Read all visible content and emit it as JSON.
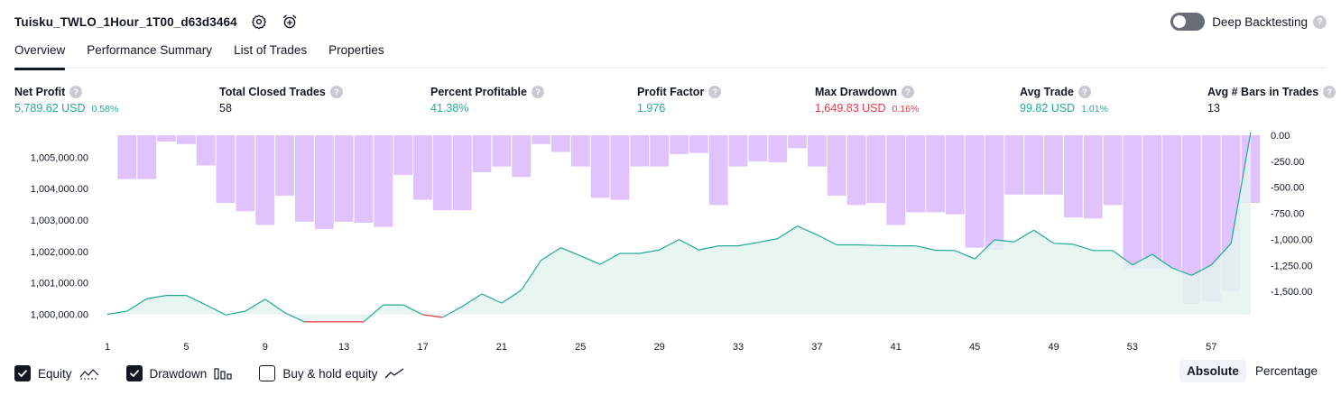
{
  "header": {
    "strategy_name": "Tuisku_TWLO_1Hour_1T00_d63d3464",
    "deep_backtesting_label": "Deep Backtesting",
    "help_glyph": "?"
  },
  "tabs": [
    {
      "label": "Overview",
      "active": true
    },
    {
      "label": "Performance Summary",
      "active": false
    },
    {
      "label": "List of Trades",
      "active": false
    },
    {
      "label": "Properties",
      "active": false
    }
  ],
  "metrics": {
    "net_profit": {
      "label": "Net Profit",
      "value": "5,789.62 USD",
      "pct": "0.58%"
    },
    "total_closed_trades": {
      "label": "Total Closed Trades",
      "value": "58"
    },
    "percent_profitable": {
      "label": "Percent Profitable",
      "value": "41.38%"
    },
    "profit_factor": {
      "label": "Profit Factor",
      "value": "1.976"
    },
    "max_drawdown": {
      "label": "Max Drawdown",
      "value": "1,649.83 USD",
      "pct": "0.16%"
    },
    "avg_trade": {
      "label": "Avg Trade",
      "value": "99.82 USD",
      "pct": "1.01%"
    },
    "avg_bars": {
      "label": "Avg # Bars in Trades",
      "value": "13"
    }
  },
  "colors": {
    "profit": "#22ab94",
    "loss": "#f23645",
    "drawdown_bar": "#dab7fd",
    "equity_fill": "#e3f4ef",
    "text": "#131722"
  },
  "chart_data": {
    "type": "line",
    "x": [
      1,
      2,
      3,
      4,
      5,
      6,
      7,
      8,
      9,
      10,
      11,
      12,
      13,
      14,
      15,
      16,
      17,
      18,
      19,
      20,
      21,
      22,
      23,
      24,
      25,
      26,
      27,
      28,
      29,
      30,
      31,
      32,
      33,
      34,
      35,
      36,
      37,
      38,
      39,
      40,
      41,
      42,
      43,
      44,
      45,
      46,
      47,
      48,
      49,
      50,
      51,
      52,
      53,
      54,
      55,
      56,
      57,
      58,
      59
    ],
    "x_tick_labels": [
      "1",
      "5",
      "9",
      "13",
      "17",
      "21",
      "25",
      "29",
      "33",
      "37",
      "41",
      "45",
      "49",
      "53",
      "57"
    ],
    "series": [
      {
        "kind": "equity",
        "axis": "left",
        "values": [
          1000000,
          1000100,
          1000500,
          1000600,
          1000600,
          1000300,
          999980,
          1000100,
          1000480,
          1000050,
          999760,
          999760,
          999760,
          999760,
          1000300,
          1000300,
          999990,
          999900,
          1000250,
          1000650,
          1000360,
          1000770,
          1001720,
          1002120,
          1001860,
          1001590,
          1001940,
          1001940,
          1002050,
          1002380,
          1002050,
          1002180,
          1002180,
          1002290,
          1002410,
          1002810,
          1002530,
          1002210,
          1002210,
          1002190,
          1002180,
          1002180,
          1002040,
          1002030,
          1001760,
          1002370,
          1002310,
          1002680,
          1002260,
          1002230,
          1002030,
          1002030,
          1001570,
          1001910,
          1001480,
          1001240,
          1001570,
          1002260,
          1005800
        ]
      },
      {
        "kind": "drawdown",
        "axis": "right",
        "values": [
          0,
          -420,
          -420,
          -60,
          -85,
          -290,
          -650,
          -730,
          -860,
          -580,
          -830,
          -900,
          -830,
          -840,
          -880,
          -380,
          -620,
          -720,
          -720,
          -355,
          -300,
          -400,
          -85,
          -160,
          -300,
          -600,
          -620,
          -300,
          -300,
          -180,
          -170,
          -670,
          -300,
          -250,
          -260,
          -125,
          -300,
          -580,
          -670,
          -650,
          -860,
          -740,
          -740,
          -760,
          -1080,
          -1100,
          -570,
          -570,
          -570,
          -790,
          -800,
          -670,
          -1280,
          -1280,
          -1290,
          -1620,
          -1600,
          -1500,
          -650
        ]
      }
    ],
    "left_axis": {
      "ylim": [
        999900,
        1005700
      ],
      "tick_labels": [
        "1,000,000.00",
        "1,001,000.00",
        "1,002,000.00",
        "1,003,000.00",
        "1,004,000.00",
        "1,005,000.00"
      ]
    },
    "right_axis": {
      "ylim": [
        -1750,
        0
      ],
      "tick_labels": [
        "0.00",
        "-250.00",
        "-500.00",
        "-750.00",
        "-1,000.00",
        "-1,250.00",
        "-1,500.00"
      ]
    }
  },
  "footer": {
    "equity_label": "Equity",
    "drawdown_label": "Drawdown",
    "buyhold_label": "Buy & hold equity",
    "absolute_label": "Absolute",
    "percentage_label": "Percentage"
  }
}
